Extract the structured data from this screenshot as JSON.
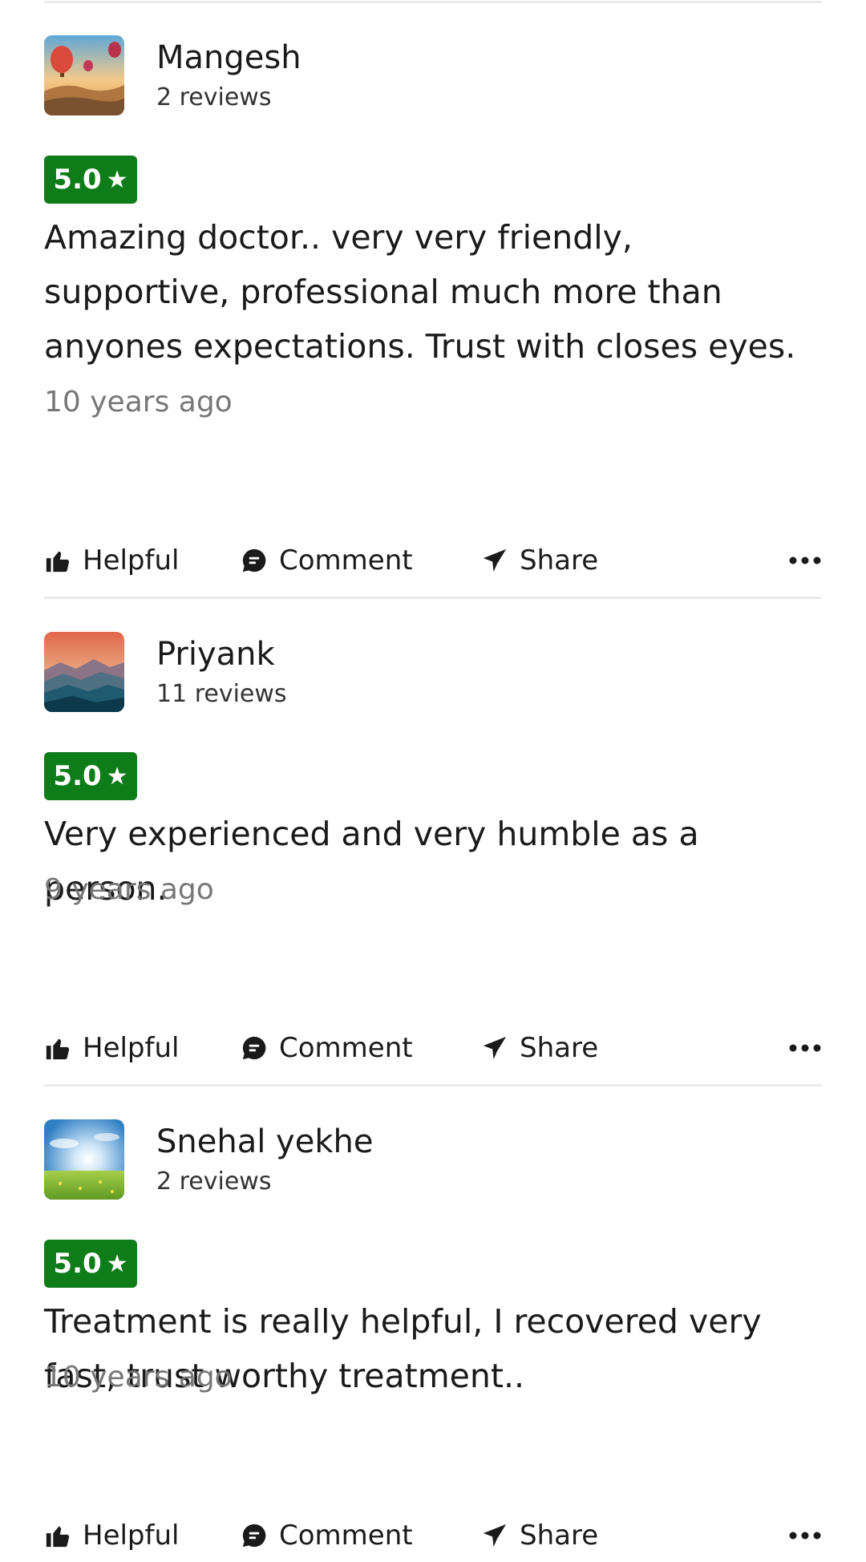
{
  "reviews": [
    {
      "name": "Mangesh",
      "review_count": "2 reviews",
      "rating": "5.0",
      "text": "Amazing doctor.. very very friendly, supportive, professional much more than anyones expectations. Trust with closes eyes.",
      "time_ago": "10 years ago",
      "avatar_icon": "hot-air-balloons-avatar"
    },
    {
      "name": "Priyank",
      "review_count": "11 reviews",
      "rating": "5.0",
      "text": "Very experienced and very humble as a person.",
      "time_ago": "9 years ago",
      "avatar_icon": "mountains-avatar"
    },
    {
      "name": "Snehal yekhe",
      "review_count": "2 reviews",
      "rating": "5.0",
      "text": "Treatment is really helpful, I recovered very fast, trust worthy treatment..",
      "time_ago": "10 years ago",
      "avatar_icon": "meadow-avatar"
    }
  ],
  "actions": {
    "helpful": "Helpful",
    "comment": "Comment",
    "share": "Share"
  },
  "colors": {
    "rating_badge": "#0e7c19",
    "divider": "#e9e9e9",
    "secondary_text": "#777777"
  }
}
